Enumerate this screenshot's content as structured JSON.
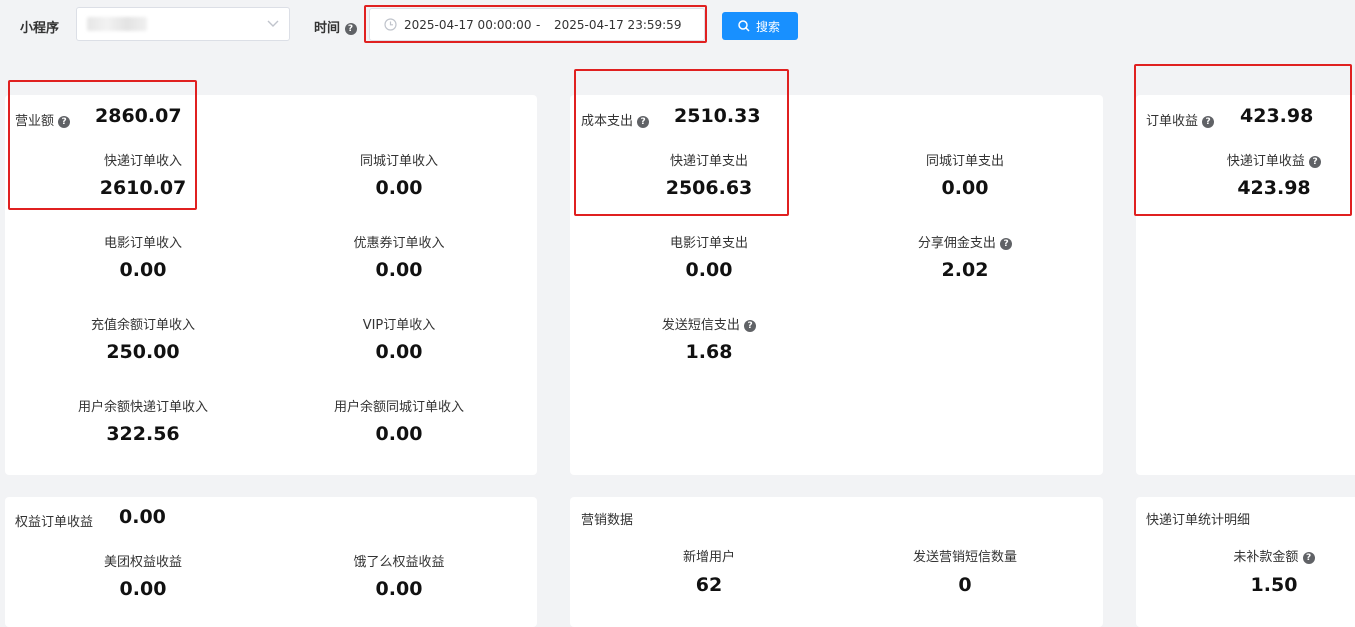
{
  "filters": {
    "miniprogram_label": "小程序",
    "time_label": "时间",
    "date_start": "2025-04-17 00:00:00",
    "date_sep": "-",
    "date_end": "2025-04-17 23:59:59",
    "search_label": "搜索"
  },
  "revenue": {
    "title": "营业额",
    "total": "2860.07",
    "items": [
      {
        "label": "快递订单收入",
        "value": "2610.07"
      },
      {
        "label": "同城订单收入",
        "value": "0.00"
      },
      {
        "label": "电影订单收入",
        "value": "0.00"
      },
      {
        "label": "优惠券订单收入",
        "value": "0.00"
      },
      {
        "label": "充值余额订单收入",
        "value": "250.00"
      },
      {
        "label": "VIP订单收入",
        "value": "0.00"
      },
      {
        "label": "用户余额快递订单收入",
        "value": "322.56"
      },
      {
        "label": "用户余额同城订单收入",
        "value": "0.00"
      }
    ]
  },
  "cost": {
    "title": "成本支出",
    "total": "2510.33",
    "items": [
      {
        "label": "快递订单支出",
        "value": "2506.63"
      },
      {
        "label": "同城订单支出",
        "value": "0.00"
      },
      {
        "label": "电影订单支出",
        "value": "0.00"
      },
      {
        "label": "分享佣金支出",
        "value": "2.02"
      },
      {
        "label": "发送短信支出",
        "value": "1.68"
      }
    ]
  },
  "profit": {
    "title": "订单收益",
    "total": "423.98",
    "items": [
      {
        "label": "快递订单收益",
        "value": "423.98"
      }
    ]
  },
  "rights": {
    "title": "权益订单收益",
    "total": "0.00",
    "items": [
      {
        "label": "美团权益收益",
        "value": "0.00"
      },
      {
        "label": "饿了么权益收益",
        "value": "0.00"
      }
    ]
  },
  "marketing": {
    "title": "营销数据",
    "items": [
      {
        "label": "新增用户",
        "value": "62"
      },
      {
        "label": "发送营销短信数量",
        "value": "0"
      }
    ]
  },
  "express_detail": {
    "title": "快递订单统计明细",
    "items": [
      {
        "label": "未补款金额",
        "value": "1.50"
      }
    ]
  },
  "colors": {
    "accent": "#1890ff",
    "highlight": "#e02020"
  }
}
